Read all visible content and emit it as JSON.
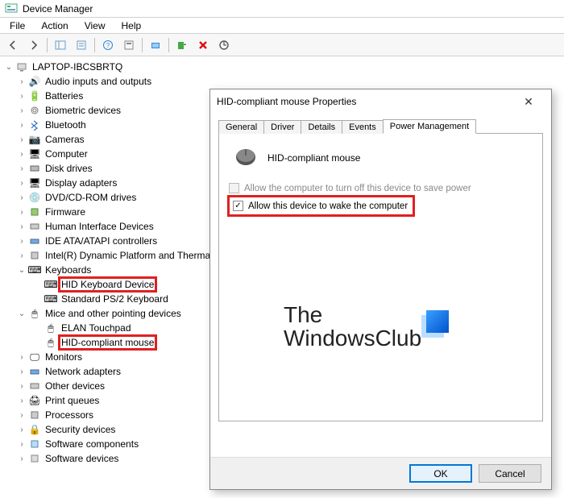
{
  "window": {
    "title": "Device Manager"
  },
  "menu": {
    "file": "File",
    "action": "Action",
    "view": "View",
    "help": "Help"
  },
  "tree": {
    "root": "LAPTOP-IBCSBRTQ",
    "audio": "Audio inputs and outputs",
    "batteries": "Batteries",
    "biometric": "Biometric devices",
    "bluetooth": "Bluetooth",
    "cameras": "Cameras",
    "computer": "Computer",
    "disk": "Disk drives",
    "display": "Display adapters",
    "dvd": "DVD/CD-ROM drives",
    "firmware": "Firmware",
    "hid": "Human Interface Devices",
    "ide": "IDE ATA/ATAPI controllers",
    "intel": "Intel(R) Dynamic Platform and Thermal Framework",
    "keyboards": "Keyboards",
    "kb_hid": "HID Keyboard Device",
    "kb_ps2": "Standard PS/2 Keyboard",
    "mice": "Mice and other pointing devices",
    "elan": "ELAN Touchpad",
    "mouse_hid": "HID-compliant mouse",
    "monitors": "Monitors",
    "network": "Network adapters",
    "other": "Other devices",
    "printq": "Print queues",
    "processors": "Processors",
    "security": "Security devices",
    "swcomp": "Software components",
    "swdev": "Software devices"
  },
  "dialog": {
    "title": "HID-compliant mouse Properties",
    "device_name": "HID-compliant mouse",
    "tabs": {
      "general": "General",
      "driver": "Driver",
      "details": "Details",
      "events": "Events",
      "power": "Power Management"
    },
    "opt_turnoff": "Allow the computer to turn off this device to save power",
    "opt_wake": "Allow this device to wake the computer",
    "ok": "OK",
    "cancel": "Cancel"
  },
  "watermark": {
    "line1": "The",
    "line2": "WindowsClub"
  }
}
